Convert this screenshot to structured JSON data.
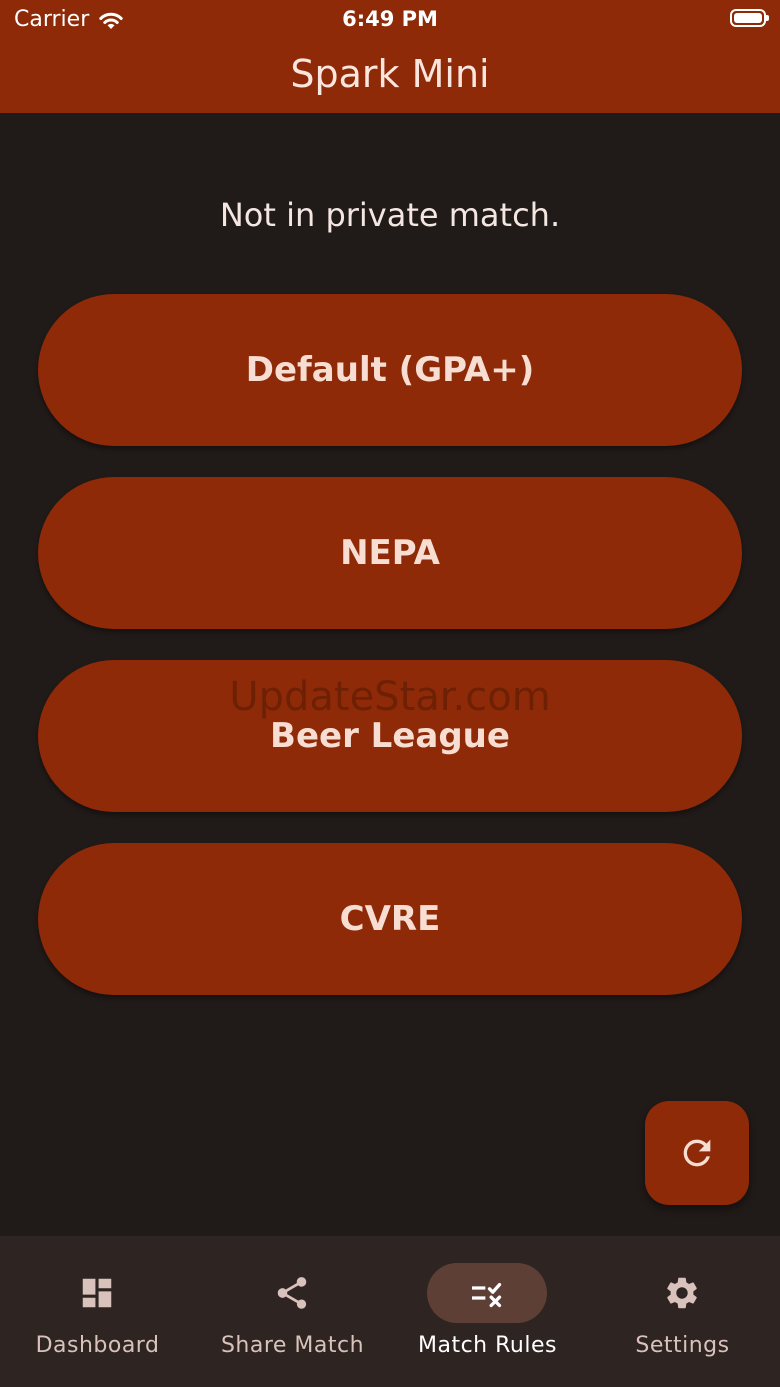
{
  "status_bar": {
    "carrier": "Carrier",
    "time": "6:49 PM"
  },
  "app": {
    "title": "Spark Mini"
  },
  "main": {
    "status_message": "Not in private match.",
    "rules": [
      {
        "label": "Default (GPA+)"
      },
      {
        "label": "NEPA"
      },
      {
        "label": "Beer League"
      },
      {
        "label": "CVRE"
      }
    ],
    "watermark": "UpdateStar.com",
    "refresh_icon": "refresh-icon"
  },
  "bottom_nav": {
    "items": [
      {
        "label": "Dashboard",
        "icon": "dashboard-icon",
        "active": false
      },
      {
        "label": "Share Match",
        "icon": "share-icon",
        "active": false
      },
      {
        "label": "Match Rules",
        "icon": "rule-icon",
        "active": true
      },
      {
        "label": "Settings",
        "icon": "gear-icon",
        "active": false
      }
    ]
  },
  "colors": {
    "primary": "#8e2a07",
    "background": "#201a18",
    "nav_background": "#2e2422",
    "nav_active_indicator": "#5e3f36"
  }
}
